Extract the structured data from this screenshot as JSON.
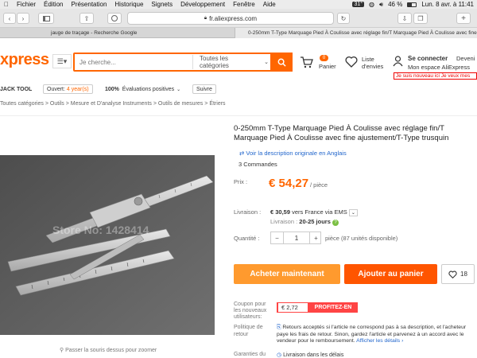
{
  "menubar": {
    "items": [
      "Fichier",
      "Édition",
      "Présentation",
      "Historique",
      "Signets",
      "Développement",
      "Fenêtre",
      "Aide"
    ],
    "temp": "31°",
    "battery": "46 %",
    "clock": "Lun. 8 avr. à 11:41"
  },
  "browser": {
    "url": "fr.aliexpress.com",
    "tabs": [
      "jauge de traçage - Recherche Google",
      "0-250mm T-Type Marquage Pied À Coulisse avec réglage fin/T Marquage Pied À Coulisse avec fine"
    ]
  },
  "header": {
    "logo": "xpress",
    "search_placeholder": "Je cherche...",
    "all_categories": "Toutes les catégories",
    "cart_count": "0",
    "cart_label": "Panier",
    "wishlist_label1": "Liste",
    "wishlist_label2": "d'envies",
    "signin": "Se connecter",
    "account": "Mon espace AliExpress",
    "become": "Deveni",
    "new_user": "Je suis nouveau ici Je veux mes"
  },
  "store": {
    "name": "JACK TOOL",
    "open_label": "Ouvert:",
    "open_years": "4 year(s)",
    "positive_pct": "100%",
    "positive_label": "Évaluations positives",
    "follow": "Suivre"
  },
  "breadcrumb": [
    "Toutes catégories",
    "Outils",
    "Mesure et D'analyse Instruments",
    "Outils de mesures",
    "Étriers"
  ],
  "product": {
    "title": "0-250mm T-Type Marquage Pied À Coulisse avec réglage fin/T Marquage Pied À Coulisse avec fine ajustement/T-Type trusquin",
    "translate_link": "Voir la description originale en Anglais",
    "orders": "3 Commandes",
    "price_label": "Prix :",
    "price": "€ 54,27",
    "per_piece": "/ pièce",
    "shipping_label": "Livraison :",
    "shipping_price": "€ 30,59",
    "shipping_dest": "vers France via EMS",
    "delivery_label": "Livraison :",
    "delivery_days": "20-25 jours",
    "quantity_label": "Quantité :",
    "quantity": "1",
    "stock": "pièce (87 unités disponible)",
    "buy_now": "Acheter maintenant",
    "add_cart": "Ajouter au panier",
    "wish_count": "18",
    "coupon_label": "Coupon pour les nouveaux utilisateurs:",
    "coupon_value": "€ 2,72",
    "coupon_btn": "PROFITEZ-EN",
    "returns_label": "Politique de retour",
    "returns_text": "Retours acceptés si l'article ne correspond pas à sa description, et l'acheteur paye les frais de retour. Sinon, gardez l'article et parvenez à un accord avec le vendeur pour le remboursement.",
    "returns_link": "Afficher les détails",
    "guarantee_label": "Garanties du",
    "guarantee_value": "Livraison dans les délais",
    "watermark": "Store No: 1428414",
    "zoom_hint": "Passer la souris dessus pour zoomer"
  },
  "colors": {
    "accent": "#ff6600",
    "buy": "#ff9a2e",
    "cart": "#ff5500",
    "link": "#2266cc"
  }
}
